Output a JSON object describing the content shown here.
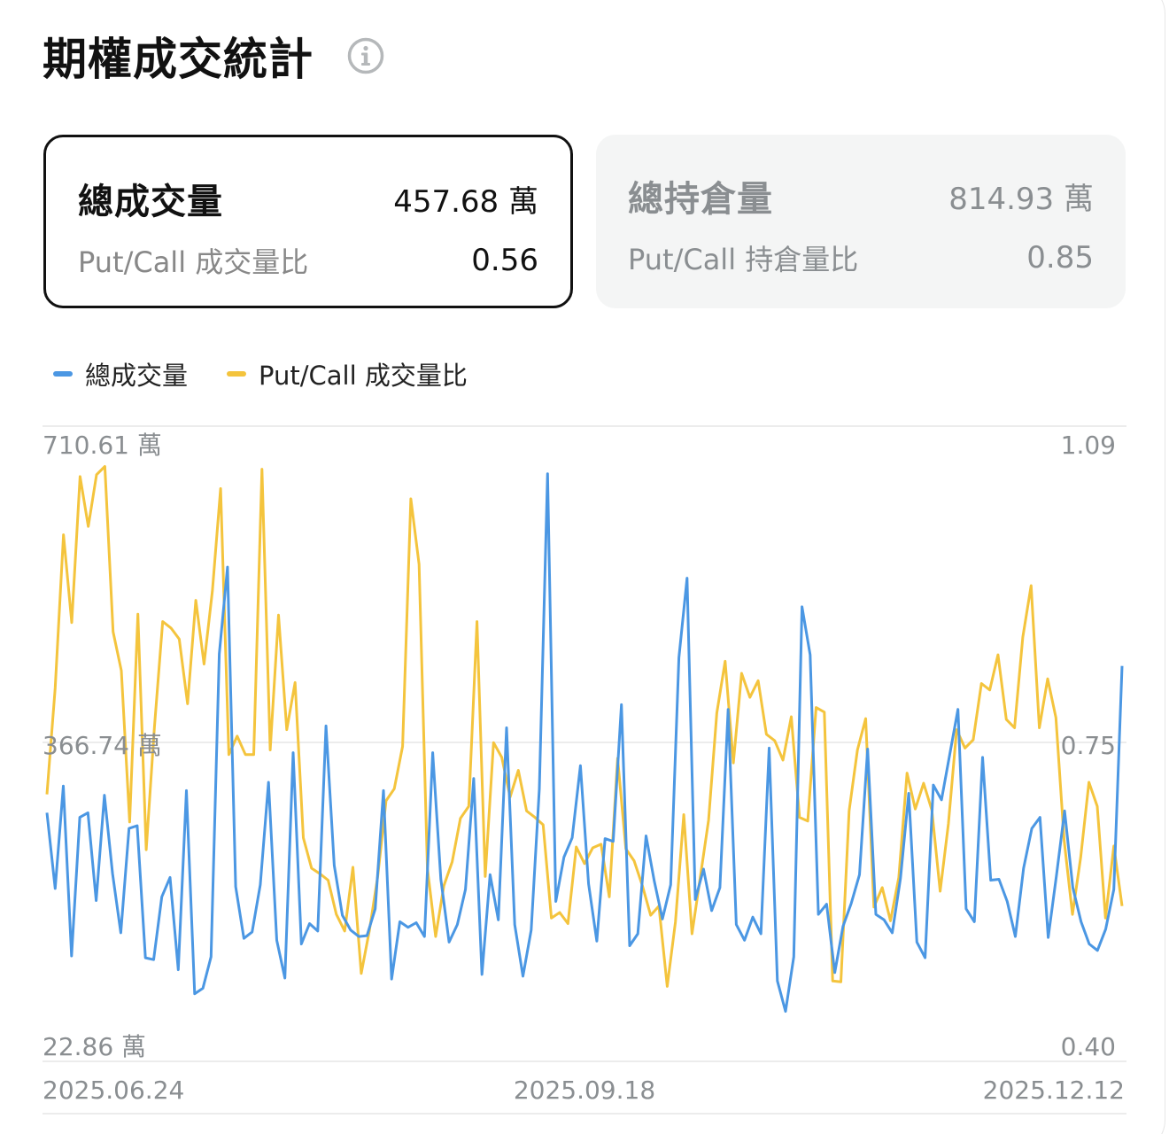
{
  "header": {
    "title": "期權成交統計"
  },
  "stats": {
    "volume": {
      "label": "總成交量",
      "value": "457.68 萬",
      "ratio_label": "Put/Call 成交量比",
      "ratio_value": "0.56"
    },
    "open_interest": {
      "label": "總持倉量",
      "value": "814.93 萬",
      "ratio_label": "Put/Call 持倉量比",
      "ratio_value": "0.85"
    }
  },
  "legend": [
    {
      "label": "總成交量",
      "color": "#4b97e3"
    },
    {
      "label": "Put/Call 成交量比",
      "color": "#f4c43d"
    }
  ],
  "colors": {
    "volume": "#4b97e3",
    "ratio": "#f4c43d",
    "grid": "#e6e6e6",
    "axis_text": "#8a8e91"
  },
  "chart_data": {
    "type": "line",
    "x_tick_labels": [
      "2025.06.24",
      "2025.09.18",
      "2025.12.12"
    ],
    "y_left_tick_labels": [
      "710.61 萬",
      "366.74 萬",
      "22.86 萬"
    ],
    "y_right_tick_labels": [
      "1.09",
      "0.75",
      "0.40"
    ],
    "y_left_range": [
      22.86,
      710.61
    ],
    "y_right_range": [
      0.4,
      1.09
    ],
    "y_left_unit": "萬",
    "grid": true,
    "legend_position": "top-left",
    "series": [
      {
        "name": "總成交量",
        "axis": "left",
        "values": [
          292,
          210,
          321,
          137,
          287,
          292,
          197,
          311,
          226,
          162,
          275,
          278,
          135,
          133,
          201,
          222,
          122,
          316,
          96,
          102,
          136,
          464,
          558,
          212,
          156,
          163,
          214,
          325,
          154,
          113,
          357,
          150,
          172,
          164,
          386,
          235,
          181,
          165,
          158,
          159,
          188,
          316,
          112,
          174,
          168,
          173,
          158,
          357,
          220,
          152,
          171,
          209,
          329,
          117,
          225,
          176,
          384,
          171,
          115,
          165,
          318,
          659,
          196,
          244,
          265,
          343,
          215,
          153,
          264,
          261,
          409,
          148,
          161,
          267,
          218,
          177,
          214,
          460,
          546,
          198,
          231,
          186,
          211,
          404,
          171,
          154,
          179,
          161,
          362,
          110,
          77,
          136,
          515,
          463,
          182,
          193,
          119,
          169,
          194,
          225,
          361,
          182,
          176,
          162,
          221,
          313,
          152,
          135,
          322,
          306,
          355,
          404,
          188,
          174,
          352,
          219,
          220,
          196,
          158,
          232,
          275,
          287,
          157,
          224,
          294,
          211,
          174,
          150,
          143,
          166,
          209,
          451
        ]
      },
      {
        "name": "Put/Call 成交量比",
        "axis": "left",
        "values": [
          312,
          427,
          593,
          498,
          656,
          602,
          658,
          667,
          488,
          446,
          282,
          507,
          252,
          385,
          499,
          492,
          480,
          410,
          522,
          453,
          532,
          643,
          355,
          375,
          355,
          355,
          664,
          360,
          506,
          382,
          433,
          265,
          232,
          226,
          219,
          182,
          164,
          233,
          118,
          165,
          223,
          305,
          318,
          364,
          632,
          561,
          232,
          158,
          213,
          239,
          286,
          299,
          499,
          223,
          368,
          352,
          309,
          338,
          294,
          287,
          279,
          178,
          184,
          172,
          255,
          237,
          254,
          258,
          201,
          351,
          253,
          240,
          213,
          181,
          191,
          104,
          174,
          290,
          161,
          222,
          284,
          400,
          456,
          346,
          443,
          417,
          435,
          377,
          370,
          349,
          396,
          287,
          283,
          406,
          401,
          110,
          109,
          294,
          360,
          394,
          190,
          211,
          175,
          222,
          335,
          296,
          324,
          295,
          207,
          280,
          382,
          362,
          371,
          432,
          425,
          463,
          393,
          384,
          482,
          538,
          384,
          437,
          395,
          262,
          182,
          244,
          325,
          299,
          178,
          256,
          191
        ]
      }
    ]
  }
}
